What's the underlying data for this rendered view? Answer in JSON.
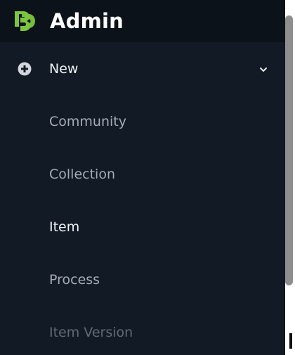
{
  "header": {
    "logo_icon": "dspace-logo-icon",
    "title": "Admin"
  },
  "menu": {
    "new": {
      "icon": "plus-circle-icon",
      "label": "New",
      "expanded": true,
      "toggle_icon": "chevron-down-icon"
    },
    "items": [
      {
        "label": "Community",
        "color": "#a5acb5"
      },
      {
        "label": "Collection",
        "color": "#a5acb5"
      },
      {
        "label": "Item",
        "color": "#eef1f4"
      },
      {
        "label": "Process",
        "color": "#a5acb5"
      },
      {
        "label": "Item Version",
        "color": "#626a73"
      }
    ]
  },
  "colors": {
    "sidebar_bg": "#111a25",
    "header_bg": "#0b121a",
    "logo_accent": "#7cc63f",
    "scrollbar": "#8e8e8e"
  }
}
